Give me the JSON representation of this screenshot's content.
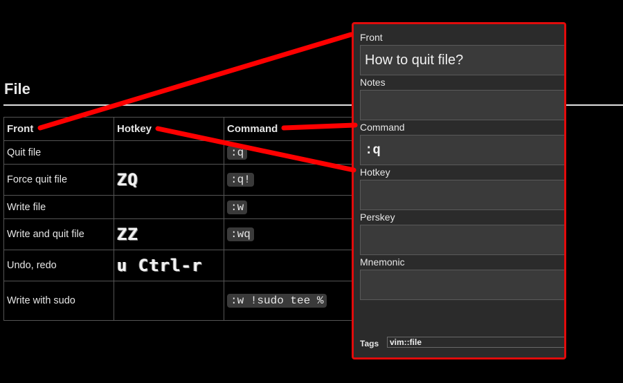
{
  "section": {
    "title": "File"
  },
  "table": {
    "headers": {
      "front": "Front",
      "hotkey": "Hotkey",
      "command": "Command"
    },
    "rows": [
      {
        "front": "Quit file",
        "hotkey": "",
        "command": ":q"
      },
      {
        "front": "Force quit file",
        "hotkey": "ZQ",
        "command": ":q!"
      },
      {
        "front": "Write file",
        "hotkey": "",
        "command": ":w"
      },
      {
        "front": "Write and quit file",
        "hotkey": "ZZ",
        "command": ":wq"
      },
      {
        "front": "Undo, redo",
        "hotkey": "u Ctrl-r",
        "command": ""
      },
      {
        "front": "Write with sudo",
        "hotkey": "",
        "command": ":w !sudo tee %"
      }
    ]
  },
  "editor": {
    "fields": {
      "front": {
        "label": "Front",
        "value": "How to quit file?"
      },
      "notes": {
        "label": "Notes",
        "value": ""
      },
      "command": {
        "label": "Command",
        "value": ":q"
      },
      "hotkey": {
        "label": "Hotkey",
        "value": ""
      },
      "perskey": {
        "label": "Perskey",
        "value": ""
      },
      "mnemonic": {
        "label": "Mnemonic",
        "value": ""
      }
    },
    "tags": {
      "label": "Tags",
      "value": "vim::file"
    }
  },
  "colors": {
    "accent": "#e20b0b",
    "background": "#000000",
    "panel": "#2b2b2b",
    "field": "#3a3a3a"
  }
}
